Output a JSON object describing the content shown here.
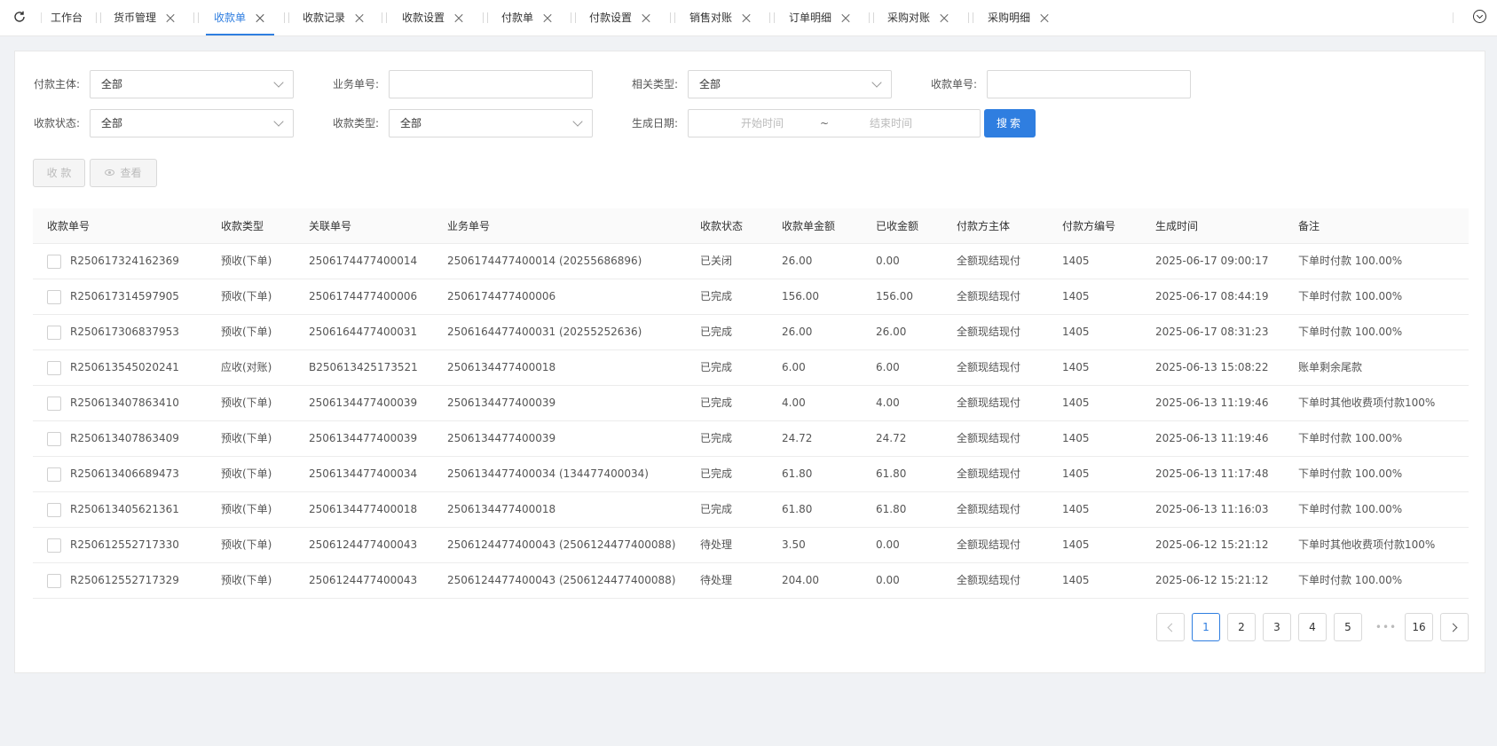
{
  "tabs": [
    {
      "label": "工作台",
      "closable": false,
      "active": false
    },
    {
      "label": "货币管理",
      "closable": true,
      "active": false
    },
    {
      "label": "收款单",
      "closable": true,
      "active": true
    },
    {
      "label": "收款记录",
      "closable": true,
      "active": false
    },
    {
      "label": "收款设置",
      "closable": true,
      "active": false
    },
    {
      "label": "付款单",
      "closable": true,
      "active": false
    },
    {
      "label": "付款设置",
      "closable": true,
      "active": false
    },
    {
      "label": "销售对账",
      "closable": true,
      "active": false
    },
    {
      "label": "订单明细",
      "closable": true,
      "active": false
    },
    {
      "label": "采购对账",
      "closable": true,
      "active": false
    },
    {
      "label": "采购明细",
      "closable": true,
      "active": false
    }
  ],
  "filters": {
    "payer_label": "付款主体:",
    "payer_value": "全部",
    "biz_no_label": "业务单号:",
    "biz_no_value": "",
    "related_type_label": "相关类型:",
    "related_type_value": "全部",
    "receipt_no_label": "收款单号:",
    "receipt_no_value": "",
    "status_label": "收款状态:",
    "status_value": "全部",
    "type_label": "收款类型:",
    "type_value": "全部",
    "date_label": "生成日期:",
    "date_start_placeholder": "开始时间",
    "date_sep": "~",
    "date_end_placeholder": "结束时间",
    "search_label": "搜索"
  },
  "actions": {
    "collect_label": "收 款",
    "view_label": "查看"
  },
  "table": {
    "columns": [
      "收款单号",
      "收款类型",
      "关联单号",
      "业务单号",
      "收款状态",
      "收款单金额",
      "已收金额",
      "付款方主体",
      "付款方编号",
      "生成时间",
      "备注"
    ],
    "rows": [
      [
        "R250617324162369",
        "预收(下单)",
        "2506174477400014",
        "2506174477400014 (20255686896)",
        "已关闭",
        "26.00",
        "0.00",
        "全额现结现付",
        "1405",
        "2025-06-17 09:00:17",
        "下单时付款 100.00%"
      ],
      [
        "R250617314597905",
        "预收(下单)",
        "2506174477400006",
        "2506174477400006",
        "已完成",
        "156.00",
        "156.00",
        "全额现结现付",
        "1405",
        "2025-06-17 08:44:19",
        "下单时付款 100.00%"
      ],
      [
        "R250617306837953",
        "预收(下单)",
        "2506164477400031",
        "2506164477400031 (20255252636)",
        "已完成",
        "26.00",
        "26.00",
        "全额现结现付",
        "1405",
        "2025-06-17 08:31:23",
        "下单时付款 100.00%"
      ],
      [
        "R250613545020241",
        "应收(对账)",
        "B250613425173521",
        "2506134477400018",
        "已完成",
        "6.00",
        "6.00",
        "全额现结现付",
        "1405",
        "2025-06-13 15:08:22",
        "账单剩余尾款"
      ],
      [
        "R250613407863410",
        "预收(下单)",
        "2506134477400039",
        "2506134477400039",
        "已完成",
        "4.00",
        "4.00",
        "全额现结现付",
        "1405",
        "2025-06-13 11:19:46",
        "下单时其他收费项付款100%"
      ],
      [
        "R250613407863409",
        "预收(下单)",
        "2506134477400039",
        "2506134477400039",
        "已完成",
        "24.72",
        "24.72",
        "全额现结现付",
        "1405",
        "2025-06-13 11:19:46",
        "下单时付款 100.00%"
      ],
      [
        "R250613406689473",
        "预收(下单)",
        "2506134477400034",
        "2506134477400034 (134477400034)",
        "已完成",
        "61.80",
        "61.80",
        "全额现结现付",
        "1405",
        "2025-06-13 11:17:48",
        "下单时付款 100.00%"
      ],
      [
        "R250613405621361",
        "预收(下单)",
        "2506134477400018",
        "2506134477400018",
        "已完成",
        "61.80",
        "61.80",
        "全额现结现付",
        "1405",
        "2025-06-13 11:16:03",
        "下单时付款 100.00%"
      ],
      [
        "R250612552717330",
        "预收(下单)",
        "2506124477400043",
        "2506124477400043 (2506124477400088)",
        "待处理",
        "3.50",
        "0.00",
        "全额现结现付",
        "1405",
        "2025-06-12 15:21:12",
        "下单时其他收费项付款100%"
      ],
      [
        "R250612552717329",
        "预收(下单)",
        "2506124477400043",
        "2506124477400043 (2506124477400088)",
        "待处理",
        "204.00",
        "0.00",
        "全额现结现付",
        "1405",
        "2025-06-12 15:21:12",
        "下单时付款 100.00%"
      ]
    ]
  },
  "pagination": {
    "pages": [
      "1",
      "2",
      "3",
      "4",
      "5"
    ],
    "current": "1",
    "ellipsis": "•••",
    "last": "16"
  },
  "colors": {
    "accent": "#2f7ee0",
    "background": "#f0f2f5"
  }
}
